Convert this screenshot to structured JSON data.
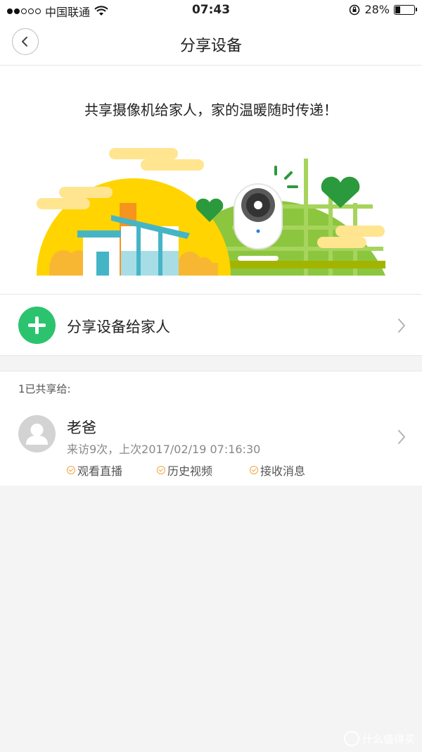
{
  "status_bar": {
    "carrier": "中国联通",
    "time": "07:43",
    "battery_percent": "28%",
    "battery_level": 0.28,
    "icons": [
      "signal-dots-icon",
      "wifi-icon",
      "orientation-lock-icon",
      "battery-icon"
    ]
  },
  "nav": {
    "title": "分享设备",
    "back_icon": "chevron-left-icon"
  },
  "hero": {
    "tagline": "共享摄像机给家人，家的温暖随时传递！"
  },
  "share_action": {
    "label": "分享设备给家人",
    "icon": "plus-icon",
    "accent_color": "#2cc36f"
  },
  "shared_section": {
    "header": "1已共享给:"
  },
  "shared_users": [
    {
      "name": "老爸",
      "visit_info": "来访9次，上次2017/02/19 07:16:30",
      "permissions": [
        "观看直播",
        "历史视频",
        "接收消息"
      ],
      "permission_icon": "check-circle-icon",
      "permission_color": "#f0a540"
    }
  ],
  "watermark": {
    "text": "什么值得买"
  }
}
